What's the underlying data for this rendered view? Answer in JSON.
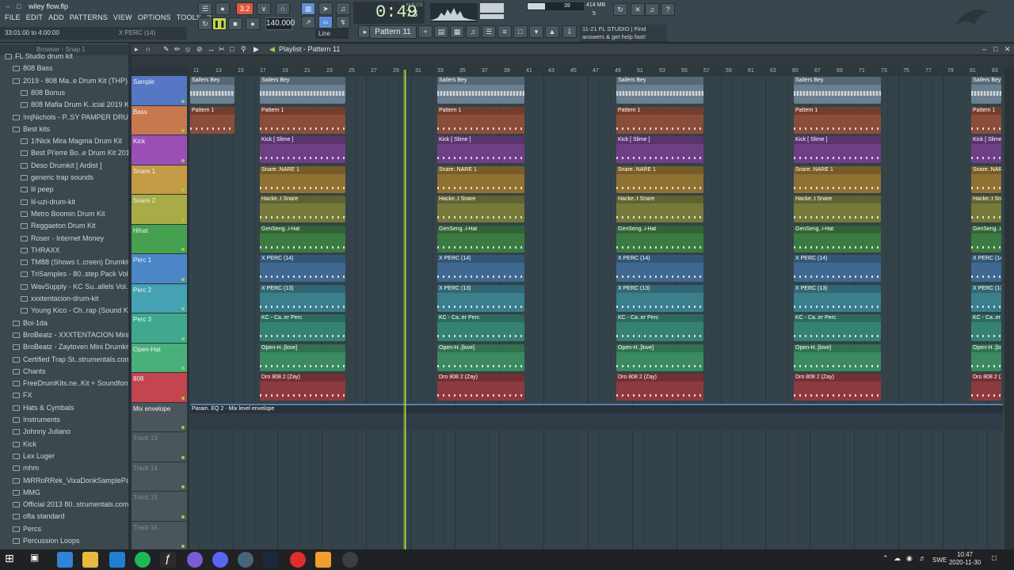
{
  "app": {
    "title": "wiley flow.flp",
    "menu": [
      "FILE",
      "EDIT",
      "ADD",
      "PATTERNS",
      "VIEW",
      "OPTIONS",
      "TOOLS",
      "?"
    ],
    "hint_left": "33:01:00 to 4:00:00",
    "hint_right": "X PERC (14)"
  },
  "transport": {
    "pat_song": "3.2",
    "time": "0:49",
    "time_sub": "73",
    "time_unit": "M:S:CS",
    "tempo": "140.000",
    "pattern": "Pattern 11",
    "snap": "Line",
    "cpu": "39",
    "memory": "414 MB",
    "poly": "5"
  },
  "news": {
    "line1": "11-21  FL STUDIO | Find",
    "line2": "answers & get help fast!"
  },
  "browser": {
    "header": "Browser - Snap 1",
    "items": [
      {
        "label": "FL Studio drum kit",
        "indent": 1
      },
      {
        "label": "808 Bass",
        "indent": 2
      },
      {
        "label": "2019 - 808 Ma..e Drum Kit (THP)",
        "indent": 2
      },
      {
        "label": "808 Bonus",
        "indent": 3
      },
      {
        "label": "808 Mafia Drum K..icial 2019 Kit",
        "indent": 3
      },
      {
        "label": "!mjNichols - P..SY PAMPER DRUMS",
        "indent": 2
      },
      {
        "label": "Best kits",
        "indent": 2
      },
      {
        "label": "1!Nick Mira Magma Drum Kit",
        "indent": 3
      },
      {
        "label": "Best Pi'erre Bo..e Drum Kit 2019",
        "indent": 3
      },
      {
        "label": "Deso Drumkit [ Ardist ]",
        "indent": 3
      },
      {
        "label": "generic trap sounds",
        "indent": 3
      },
      {
        "label": "lil peep",
        "indent": 3
      },
      {
        "label": "lil-uzi-drum-kit",
        "indent": 3
      },
      {
        "label": "Metro Boomin Drum Kit",
        "indent": 3
      },
      {
        "label": "Reggaeton Drum Kit",
        "indent": 3
      },
      {
        "label": "Roser - Internet Money",
        "indent": 3
      },
      {
        "label": "THRAXX",
        "indent": 3
      },
      {
        "label": "TM88 (Shows t..creen) Drumkit",
        "indent": 3
      },
      {
        "label": "TriSamples - 80..step Pack Vol 1",
        "indent": 3
      },
      {
        "label": "WavSupply - KC Su..allels Vol. III",
        "indent": 3
      },
      {
        "label": "xxxtentacion-drum-kit",
        "indent": 3
      },
      {
        "label": "Young Kico - Ch..rap (Sound Kit)",
        "indent": 3
      },
      {
        "label": "Boi-1da",
        "indent": 2
      },
      {
        "label": "BroBeatz - XXXTENTACION MiniKit",
        "indent": 2
      },
      {
        "label": "BroBeatz - Zaytoven Mini Drumkit",
        "indent": 2
      },
      {
        "label": "Certified Trap St..strumentals.com)",
        "indent": 2
      },
      {
        "label": "Chants",
        "indent": 2
      },
      {
        "label": "FreeDrumKits.ne..Kit + Soundfonts",
        "indent": 2
      },
      {
        "label": "FX",
        "indent": 2
      },
      {
        "label": "Hats & Cymbals",
        "indent": 2
      },
      {
        "label": "Instruments",
        "indent": 2
      },
      {
        "label": "Johnny Juliano",
        "indent": 2
      },
      {
        "label": "Kick",
        "indent": 2
      },
      {
        "label": "Lex Luger",
        "indent": 2
      },
      {
        "label": "mhm",
        "indent": 2
      },
      {
        "label": "MiRRoRRek_VixaDonkSamplePack",
        "indent": 2
      },
      {
        "label": "MMG",
        "indent": 2
      },
      {
        "label": "Official 2013 80..strumentals.com)",
        "indent": 2
      },
      {
        "label": "ofta standard",
        "indent": 2
      },
      {
        "label": "Percs",
        "indent": 2
      },
      {
        "label": "Percussion Loops",
        "indent": 2
      }
    ]
  },
  "playlist": {
    "title": "Playlist - Pattern 11",
    "ruler": [
      "11",
      "13",
      "15",
      "17",
      "19",
      "21",
      "23",
      "25",
      "27",
      "29",
      "31",
      "33",
      "35",
      "37",
      "39",
      "41",
      "43",
      "45",
      "47",
      "49",
      "51",
      "53",
      "55",
      "57",
      "59",
      "61",
      "63",
      "65",
      "67",
      "69",
      "71",
      "73",
      "75",
      "77",
      "79",
      "81",
      "83"
    ],
    "tracks": [
      {
        "name": "Sample",
        "color": "#5577c4",
        "clip_color": "#6a7f8f",
        "clip": "Sailers Bey"
      },
      {
        "name": "Bass",
        "color": "#c7784f",
        "clip_color": "#8a4d3a",
        "clip": "Pattern 1"
      },
      {
        "name": "Kick",
        "color": "#9a4fb6",
        "clip_color": "#6f3f86",
        "clip": "Kick [ Slime ]"
      },
      {
        "name": "Snare 1",
        "color": "#c49a45",
        "clip_color": "#8f7132",
        "clip": "Snare..NARE 1"
      },
      {
        "name": "Snare 2",
        "color": "#a8ac47",
        "clip_color": "#76793a",
        "clip": "Hacke..t Snare"
      },
      {
        "name": "Hihat",
        "color": "#45a04f",
        "clip_color": "#3b7b42",
        "clip": "GenSeng..i-Hat"
      },
      {
        "name": "Perc 1",
        "color": "#4d86c6",
        "clip_color": "#3f6990",
        "clip": "X PERC (14)"
      },
      {
        "name": "Perc 2",
        "color": "#44a2b3",
        "clip_color": "#3b7e8c",
        "clip": "X PERC (13)"
      },
      {
        "name": "Perc 3",
        "color": "#3fa88f",
        "clip_color": "#368270",
        "clip": "KC - Ca..er Perc"
      },
      {
        "name": "Open-Hat",
        "color": "#48b07a",
        "clip_color": "#3b8a60",
        "clip": "Open-H..[love]"
      },
      {
        "name": "808",
        "color": "#c2454f",
        "clip_color": "#8c3a40",
        "clip": "Dro 808 2 (Zay)"
      },
      {
        "name": "Mix envelope",
        "color": "#4a565c",
        "clip_color": "#3b4c66",
        "clip": "Param. EQ 2 - Mix level envelope"
      },
      {
        "name": "Track 13",
        "color": "#4a565c",
        "clip_color": "",
        "clip": ""
      },
      {
        "name": "Track 14",
        "color": "#4a565c",
        "clip_color": "",
        "clip": ""
      },
      {
        "name": "Track 15",
        "color": "#4a565c",
        "clip_color": "",
        "clip": ""
      },
      {
        "name": "Track 16",
        "color": "#4a565c",
        "clip_color": "",
        "clip": ""
      }
    ],
    "alt_clip": "Pattern 11"
  },
  "taskbar": {
    "lang": "SWE",
    "time": "10:47",
    "date": "2020-11-30"
  }
}
